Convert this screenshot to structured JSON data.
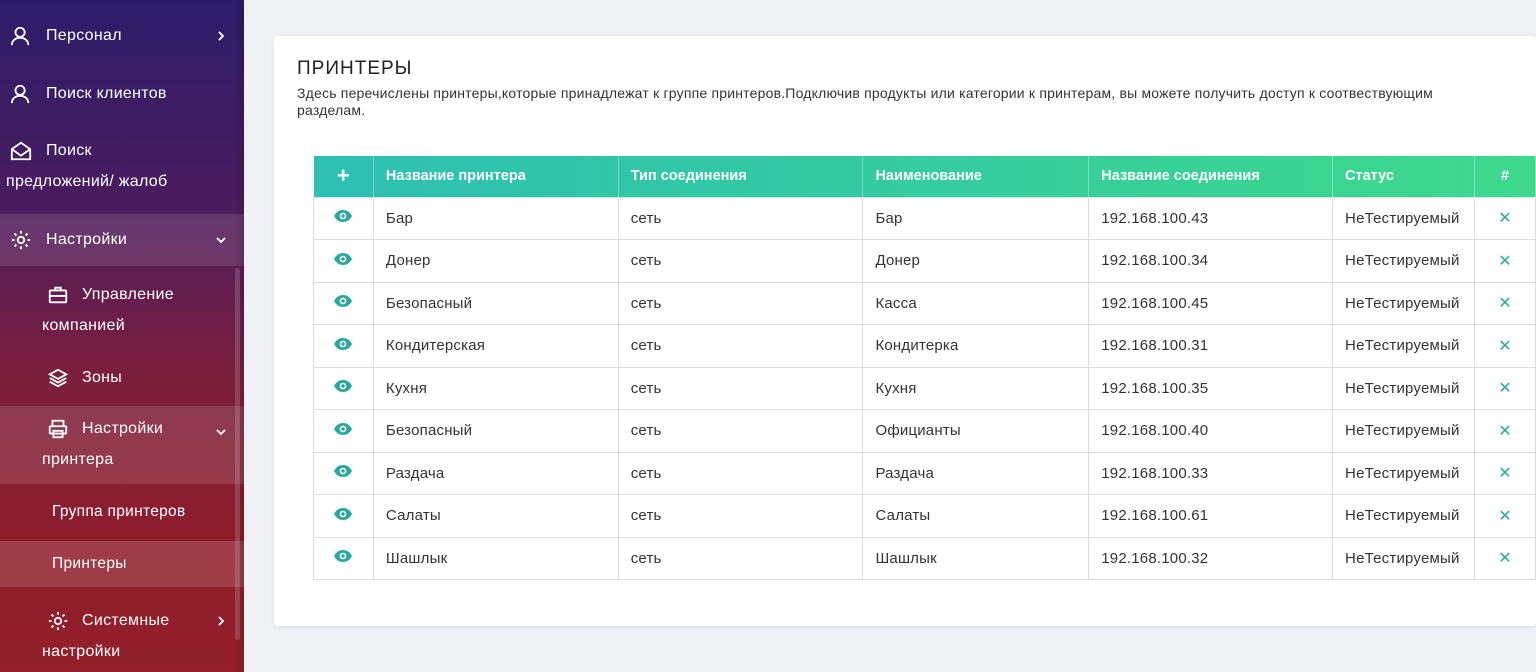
{
  "sidebar": {
    "items": [
      {
        "label": "Персонал",
        "icon": "user-icon"
      },
      {
        "label": "Поиск клиентов",
        "icon": "user-search-icon"
      },
      {
        "label_line1": "Поиск",
        "label_line2": "предложений/ жалоб",
        "icon": "envelope-open-icon"
      },
      {
        "label": "Настройки",
        "icon": "gear-icon"
      },
      {
        "label_line1": "Управление",
        "label_line2": "компанией",
        "icon": "briefcase-icon"
      },
      {
        "label": "Зоны",
        "icon": "layers-icon"
      },
      {
        "label_line1": "Настройки",
        "label_line2": "принтера",
        "icon": "printer-icon"
      },
      {
        "label": "Группа принтеров"
      },
      {
        "label": "Принтеры"
      },
      {
        "label_line1": "Системные",
        "label_line2": "настройки",
        "icon": "gear-icon"
      }
    ]
  },
  "page": {
    "title": "ПРИНТЕРЫ",
    "description": "Здесь перечислены принтеры,которые принадлежат к группе принтеров.Подключив продукты или категории к принтерам, вы можете получить доступ к соотвествующим разделам."
  },
  "table": {
    "add_label": "+",
    "columns": [
      "Название принтера",
      "Тип соединения",
      "Наименование",
      "Название соединения",
      "Статус",
      "#"
    ],
    "delete_label": "✕",
    "rows": [
      {
        "name": "Бар",
        "type": "сеть",
        "title": "Бар",
        "connection": "192.168.100.43",
        "status": "НеТестируемый"
      },
      {
        "name": "Донер",
        "type": "сеть",
        "title": "Донер",
        "connection": "192.168.100.34",
        "status": "НеТестируемый"
      },
      {
        "name": "Безопасный",
        "type": "сеть",
        "title": "Касса",
        "connection": "192.168.100.45",
        "status": "НеТестируемый"
      },
      {
        "name": "Кондитерская",
        "type": "сеть",
        "title": "Кондитерка",
        "connection": "192.168.100.31",
        "status": "НеТестируемый"
      },
      {
        "name": "Кухня",
        "type": "сеть",
        "title": "Кухня",
        "connection": "192.168.100.35",
        "status": "НеТестируемый"
      },
      {
        "name": "Безопасный",
        "type": "сеть",
        "title": "Официанты",
        "connection": "192.168.100.40",
        "status": "НеТестируемый"
      },
      {
        "name": "Раздача",
        "type": "сеть",
        "title": "Раздача",
        "connection": "192.168.100.33",
        "status": "НеТестируемый"
      },
      {
        "name": "Салаты",
        "type": "сеть",
        "title": "Салаты",
        "connection": "192.168.100.61",
        "status": "НеТестируемый"
      },
      {
        "name": "Шашлык",
        "type": "сеть",
        "title": "Шашлык",
        "connection": "192.168.100.32",
        "status": "НеТестируемый"
      }
    ]
  },
  "colors": {
    "accent": "#2ebfb1",
    "accent_end": "#3fd88d",
    "icon_teal": "#2aa89e"
  }
}
